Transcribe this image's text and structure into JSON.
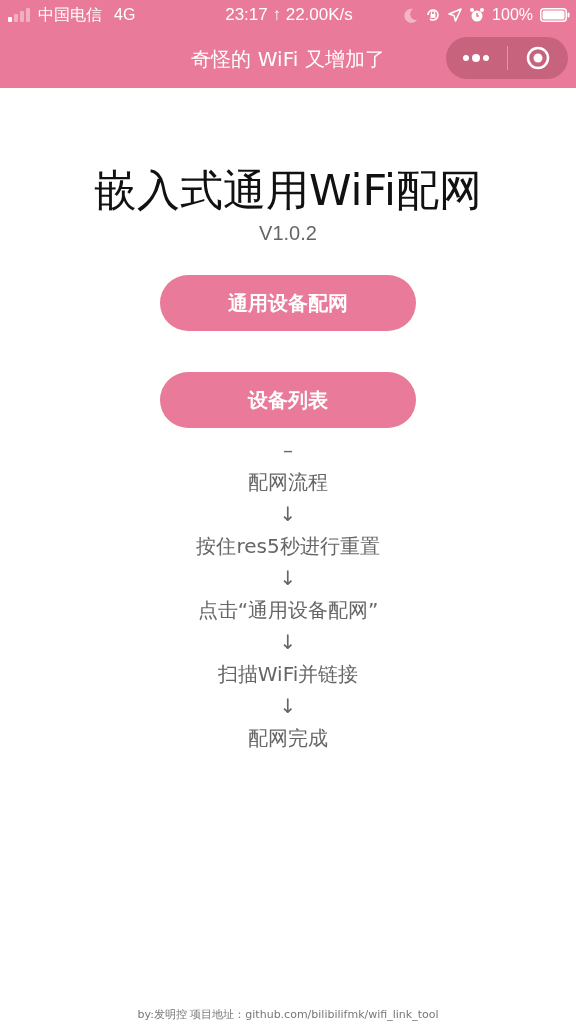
{
  "status_bar": {
    "carrier": "中国电信",
    "network": "4G",
    "time": "23:17 ↑ 22.00K/s",
    "battery": "100%"
  },
  "nav_bar": {
    "title": "奇怪的 WiFi 又增加了"
  },
  "title": "嵌入式通用WiFi配网",
  "version": "V1.0.2",
  "buttons": [
    "通用设备配网",
    "设备列表"
  ],
  "flow": [
    "–",
    "配网流程",
    "↓",
    "按住res5秒进行重置",
    "↓",
    "点击“通用设备配网”",
    "↓",
    "扫描WiFi并链接",
    "↓",
    "配网完成"
  ],
  "footer": "by:发明控 项目地址：github.com/bilibilifmk/wifi_link_tool"
}
